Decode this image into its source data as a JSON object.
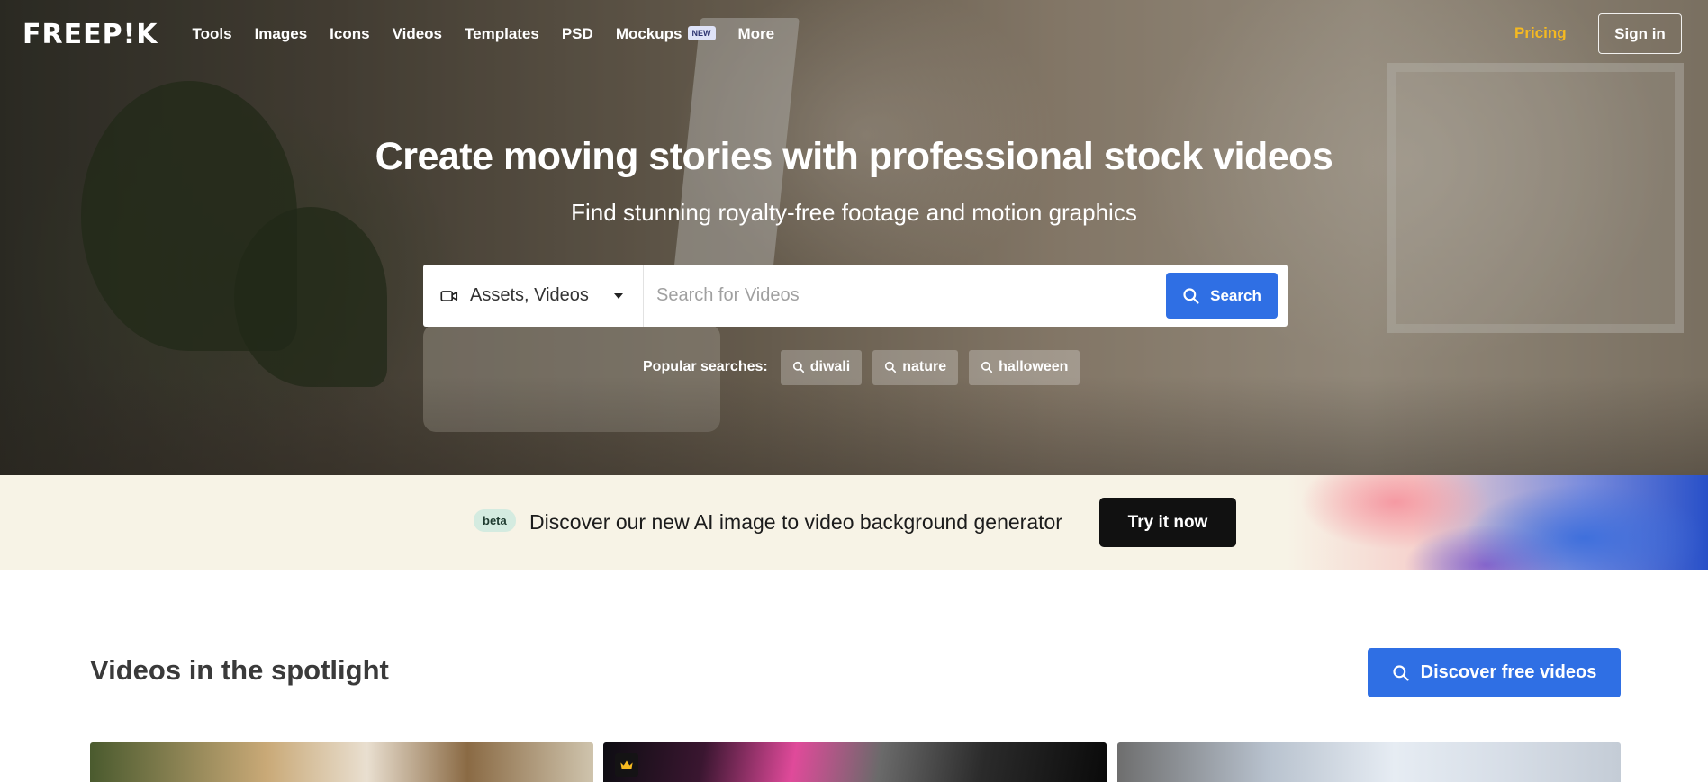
{
  "header": {
    "logo": "FREEP!K",
    "nav": [
      {
        "label": "Tools"
      },
      {
        "label": "Images"
      },
      {
        "label": "Icons"
      },
      {
        "label": "Videos"
      },
      {
        "label": "Templates"
      },
      {
        "label": "PSD"
      },
      {
        "label": "Mockups",
        "badge": "NEW"
      },
      {
        "label": "More"
      }
    ],
    "pricing": "Pricing",
    "sign_in": "Sign in"
  },
  "hero": {
    "title": "Create moving stories with professional stock videos",
    "subtitle": "Find stunning royalty-free footage and motion graphics"
  },
  "search": {
    "category": "Assets, Videos",
    "placeholder": "Search for Videos",
    "button": "Search",
    "icons": {
      "category": "video-camera-icon",
      "button": "search-icon"
    }
  },
  "popular": {
    "label": "Popular searches:",
    "items": [
      "diwali",
      "nature",
      "halloween"
    ]
  },
  "banner": {
    "badge": "beta",
    "text": "Discover our new AI image to video background generator",
    "button": "Try it now"
  },
  "spotlight": {
    "title": "Videos in the spotlight",
    "button": "Discover free videos",
    "thumbnails": [
      {
        "premium": false
      },
      {
        "premium": true,
        "badge_icon": "crown-icon"
      },
      {
        "premium": false
      }
    ]
  },
  "colors": {
    "accent_blue": "#2f6fe4",
    "pricing_yellow": "#f5b921",
    "banner_bg": "#f7f3e6",
    "dark_button": "#111111"
  }
}
